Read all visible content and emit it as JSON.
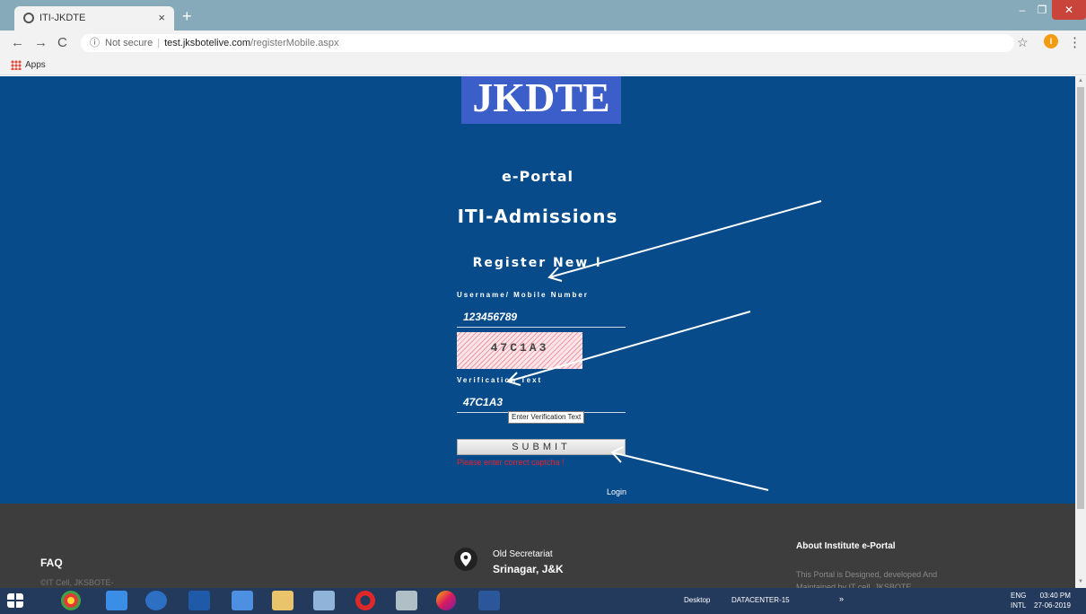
{
  "browser": {
    "tab_title": "ITI-JKDTE",
    "tab_close": "×",
    "new_tab": "+",
    "nav_back": "←",
    "nav_forward": "→",
    "nav_reload": "C",
    "security_icon": "ⓘ",
    "security_label": "Not secure",
    "url_host": "test.jksbotelive.com",
    "url_path": "/registerMobile.aspx",
    "bookmark_star": "☆",
    "profile_initial": "I",
    "menu_glyph": "⋮",
    "apps_label": "Apps",
    "win_min": "–",
    "win_max": "❐",
    "win_close": "✕"
  },
  "page": {
    "logo": "JKDTE",
    "eportal": "e-Portal",
    "admissions": "ITI-Admissions",
    "register_heading": "Register New !",
    "username_label": "Username/ Mobile Number",
    "username_value": "123456789",
    "captcha_text": "47C1A3",
    "verification_label": "Verification Text",
    "verification_value": "47C1A3",
    "verification_tooltip": "Enter Verification Text",
    "submit_label": "SUBMIT",
    "error_text": "Please enter correct captcha !",
    "login_link": "Login"
  },
  "footer": {
    "faq": "FAQ",
    "copyright": "©IT Cell, JKSBOTE-",
    "address_line1": "Old Secretariat",
    "address_line2": "Srinagar, J&K",
    "about_heading": "About Institute e-Portal",
    "about_text": "This Portal is Designed, developed And Maintained by IT cell, JKSBOTE"
  },
  "taskbar": {
    "desktop_label": "Desktop",
    "datacenter_label": "DATACENTER-15",
    "tray_chevron": "»",
    "lang_line1": "ENG",
    "lang_line2": "INTL",
    "time": "03:40 PM",
    "date": "27-06-2019"
  },
  "colors": {
    "hero_bg": "#074b8a",
    "logo_bg": "#3c5ec9",
    "footer_bg": "#3d3d3d",
    "error": "#e8232d",
    "taskbar": "#243a5c"
  }
}
